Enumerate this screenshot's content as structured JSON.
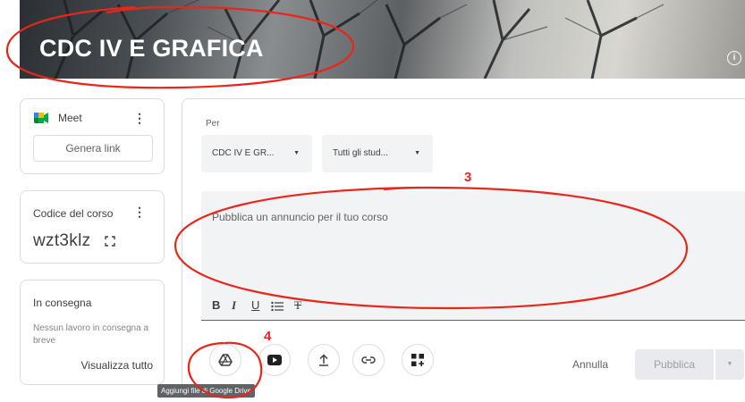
{
  "course": {
    "title": "CDC IV E GRAFICA",
    "info_icon": "info-icon"
  },
  "sidebar": {
    "meet": {
      "label": "Meet",
      "button": "Genera link",
      "icon": "google-meet-icon"
    },
    "code": {
      "label": "Codice del corso",
      "value": "wzt3klz",
      "icon": "fullscreen-icon"
    },
    "due": {
      "label": "In consegna",
      "empty": "Nessun lavoro in consegna a breve",
      "link": "Visualizza tutto"
    }
  },
  "composer": {
    "for_label": "Per",
    "class_select": "CDC IV E GR...",
    "students_select": "Tutti gli stud...",
    "placeholder": "Pubblica un annuncio per il tuo corso",
    "format": {
      "bold": "B",
      "italic": "I",
      "underline": "U",
      "clear": "T"
    },
    "cancel": "Annulla",
    "publish": "Pubblica",
    "tooltip": "Aggiungi file di Google Drive"
  },
  "annotations": {
    "three": "3",
    "four": "4",
    "color": "#e8261b"
  }
}
